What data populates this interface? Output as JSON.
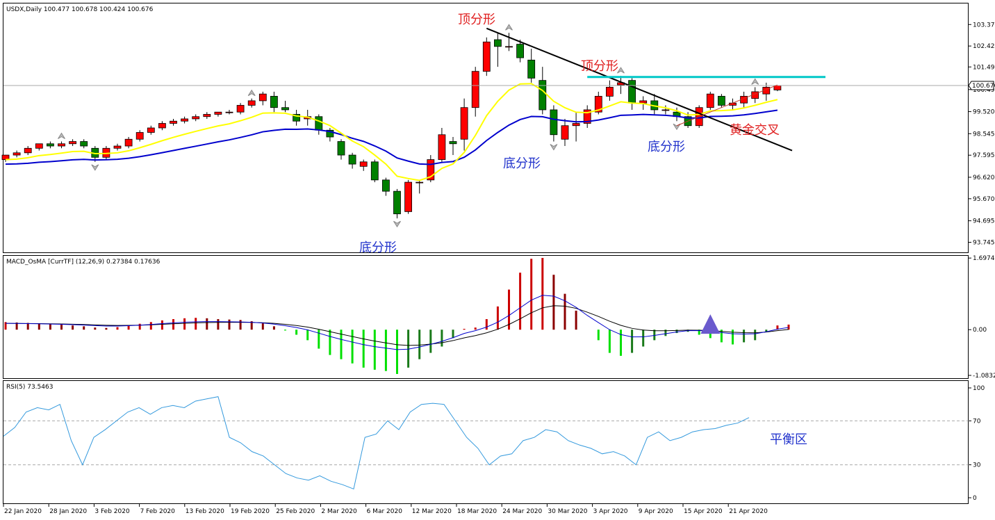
{
  "header": {
    "symbol_line": "USDX,Daily  100.477 100.678 100.424 100.676",
    "macd_line": "MACD_OsMA [CurrTF] (12,26,9) 0.27384 0.17636",
    "rsi_line": "RSI(5) 73.5463"
  },
  "price_tag": "100.676",
  "colors": {
    "up": "#ff0000",
    "down": "#008000",
    "ma_fast": "#ffff00",
    "ma_slow": "#0000cd",
    "trendline": "#000000",
    "resistance": "#00c8c8",
    "macd_pos": "#cc0000",
    "macd_neg": "#00e000",
    "rsi_line": "#3399dd",
    "annot_red": "#e02020",
    "annot_blue": "#2233cc",
    "triangle": "#6a5acd"
  },
  "annotations": [
    {
      "text": "顶分形",
      "color": "red"
    },
    {
      "text": "顶分形",
      "color": "red"
    },
    {
      "text": "底分形",
      "color": "blue"
    },
    {
      "text": "底分形",
      "color": "blue"
    },
    {
      "text": "底分形",
      "color": "blue"
    },
    {
      "text": "黄金交叉",
      "color": "red"
    },
    {
      "text": "平衡区",
      "color": "blue"
    }
  ],
  "chart_data": [
    {
      "type": "candlestick",
      "panel": "price",
      "ylim": [
        93.3,
        104.3
      ],
      "y_ticks": [
        "103.370",
        "102.420",
        "101.495",
        "100.495",
        "99.520",
        "98.545",
        "97.595",
        "96.620",
        "95.670",
        "94.695",
        "93.745"
      ],
      "x_labels": [
        "22 Jan 2020",
        "28 Jan 2020",
        "3 Feb 2020",
        "7 Feb 2020",
        "13 Feb 2020",
        "19 Feb 2020",
        "25 Feb 2020",
        "2 Mar 2020",
        "6 Mar 2020",
        "12 Mar 2020",
        "18 Mar 2020",
        "24 Mar 2020",
        "30 Mar 2020",
        "3 Apr 2020",
        "9 Apr 2020",
        "15 Apr 2020",
        "21 Apr 2020"
      ],
      "candles": [
        [
          97.4,
          97.6,
          97.3,
          97.6
        ],
        [
          97.6,
          97.8,
          97.5,
          97.7
        ],
        [
          97.7,
          98.0,
          97.6,
          97.9
        ],
        [
          97.9,
          98.1,
          97.8,
          98.1
        ],
        [
          98.1,
          98.2,
          97.9,
          98.0
        ],
        [
          98.0,
          98.2,
          97.9,
          98.1
        ],
        [
          98.1,
          98.3,
          98.0,
          98.2
        ],
        [
          98.2,
          98.3,
          97.9,
          98.0
        ],
        [
          97.9,
          98.0,
          97.3,
          97.5
        ],
        [
          97.5,
          98.0,
          97.4,
          97.9
        ],
        [
          97.9,
          98.1,
          97.8,
          98.0
        ],
        [
          98.0,
          98.4,
          97.9,
          98.3
        ],
        [
          98.3,
          98.7,
          98.2,
          98.6
        ],
        [
          98.6,
          98.9,
          98.5,
          98.8
        ],
        [
          98.8,
          99.1,
          98.7,
          99.0
        ],
        [
          99.0,
          99.2,
          98.9,
          99.1
        ],
        [
          99.1,
          99.3,
          99.0,
          99.2
        ],
        [
          99.2,
          99.4,
          99.1,
          99.3
        ],
        [
          99.3,
          99.5,
          99.2,
          99.4
        ],
        [
          99.4,
          99.5,
          99.3,
          99.5
        ],
        [
          99.5,
          99.6,
          99.4,
          99.5
        ],
        [
          99.5,
          99.9,
          99.4,
          99.8
        ],
        [
          99.8,
          100.1,
          99.7,
          100.0
        ],
        [
          100.0,
          100.4,
          99.8,
          100.3
        ],
        [
          100.2,
          100.4,
          99.5,
          99.7
        ],
        [
          99.7,
          100.0,
          99.5,
          99.6
        ],
        [
          99.4,
          99.6,
          98.9,
          99.1
        ],
        [
          99.2,
          99.6,
          98.9,
          99.3
        ],
        [
          99.3,
          99.4,
          98.5,
          98.7
        ],
        [
          98.7,
          98.8,
          98.2,
          98.4
        ],
        [
          98.2,
          98.3,
          97.4,
          97.6
        ],
        [
          97.6,
          97.7,
          97.0,
          97.2
        ],
        [
          97.1,
          97.4,
          96.9,
          97.3
        ],
        [
          97.3,
          97.4,
          96.4,
          96.5
        ],
        [
          96.5,
          96.6,
          95.8,
          96.0
        ],
        [
          96.0,
          96.1,
          94.8,
          95.0
        ],
        [
          95.1,
          96.5,
          95.0,
          96.4
        ],
        [
          96.4,
          96.5,
          95.9,
          96.4
        ],
        [
          96.5,
          97.6,
          96.4,
          97.4
        ],
        [
          97.4,
          98.8,
          97.3,
          98.5
        ],
        [
          98.2,
          98.4,
          97.6,
          98.1
        ],
        [
          98.3,
          100.1,
          97.8,
          99.7
        ],
        [
          99.7,
          101.5,
          99.3,
          101.3
        ],
        [
          101.3,
          102.8,
          101.1,
          102.6
        ],
        [
          102.7,
          103.0,
          101.5,
          102.4
        ],
        [
          102.4,
          103.0,
          102.2,
          102.4
        ],
        [
          102.5,
          102.7,
          101.7,
          101.9
        ],
        [
          101.8,
          102.3,
          100.8,
          101.0
        ],
        [
          100.9,
          101.5,
          99.4,
          99.6
        ],
        [
          99.6,
          99.8,
          98.2,
          98.5
        ],
        [
          98.3,
          99.2,
          98.0,
          98.9
        ],
        [
          98.9,
          99.5,
          98.2,
          99.0
        ],
        [
          99.0,
          99.8,
          98.8,
          99.6
        ],
        [
          99.5,
          100.4,
          99.4,
          100.2
        ],
        [
          100.2,
          100.9,
          100.0,
          100.6
        ],
        [
          100.7,
          101.1,
          100.3,
          100.8
        ],
        [
          100.9,
          101.0,
          99.6,
          99.9
        ],
        [
          99.9,
          100.2,
          99.6,
          100.0
        ],
        [
          100.0,
          100.3,
          99.4,
          99.6
        ],
        [
          99.6,
          99.8,
          99.4,
          99.6
        ],
        [
          99.5,
          99.7,
          99.1,
          99.3
        ],
        [
          99.3,
          99.5,
          98.8,
          98.9
        ],
        [
          98.9,
          99.8,
          98.8,
          99.7
        ],
        [
          99.7,
          100.4,
          99.6,
          100.3
        ],
        [
          100.2,
          100.3,
          99.7,
          99.8
        ],
        [
          99.8,
          100.1,
          99.6,
          99.9
        ],
        [
          99.9,
          100.4,
          99.7,
          100.2
        ],
        [
          100.1,
          100.6,
          99.9,
          100.4
        ],
        [
          100.3,
          100.8,
          100.0,
          100.6
        ],
        [
          100.477,
          100.678,
          100.424,
          100.676
        ]
      ]
    },
    {
      "type": "bar",
      "panel": "macd",
      "ylim": [
        -1.15,
        1.75
      ],
      "y_ticks": [
        "1.69749",
        "0.00",
        "-1.08328"
      ],
      "values": [
        0.18,
        0.17,
        0.16,
        0.15,
        0.14,
        0.12,
        0.1,
        0.08,
        0.05,
        0.04,
        0.06,
        0.1,
        0.14,
        0.18,
        0.22,
        0.25,
        0.27,
        0.28,
        0.27,
        0.25,
        0.24,
        0.23,
        0.2,
        0.15,
        0.08,
        -0.02,
        -0.12,
        -0.25,
        -0.45,
        -0.6,
        -0.7,
        -0.8,
        -0.9,
        -0.95,
        -0.98,
        -1.05,
        -0.9,
        -0.7,
        -0.55,
        -0.4,
        -0.2,
        0.02,
        0.05,
        0.25,
        0.55,
        0.95,
        1.35,
        1.68,
        1.7,
        1.3,
        0.85,
        0.45,
        0.0,
        -0.25,
        -0.55,
        -0.62,
        -0.55,
        -0.4,
        -0.25,
        -0.15,
        -0.08,
        -0.05,
        -0.12,
        -0.2,
        -0.3,
        -0.35,
        -0.3,
        -0.25,
        -0.05,
        0.1,
        0.12
      ]
    },
    {
      "type": "line",
      "panel": "rsi",
      "ylim": [
        0,
        100
      ],
      "y_ticks": [
        "100",
        "70",
        "30",
        "0"
      ],
      "values": [
        56,
        64,
        78,
        82,
        80,
        85,
        52,
        30,
        55,
        62,
        70,
        78,
        82,
        76,
        82,
        84,
        82,
        88,
        90,
        92,
        55,
        50,
        42,
        38,
        30,
        22,
        18,
        16,
        20,
        15,
        12,
        8,
        55,
        58,
        70,
        62,
        78,
        85,
        86,
        85,
        70,
        55,
        45,
        30,
        38,
        40,
        52,
        55,
        62,
        60,
        52,
        48,
        45,
        40,
        42,
        38,
        30,
        55,
        60,
        52,
        55,
        60,
        62,
        63,
        66,
        68,
        73
      ]
    }
  ]
}
